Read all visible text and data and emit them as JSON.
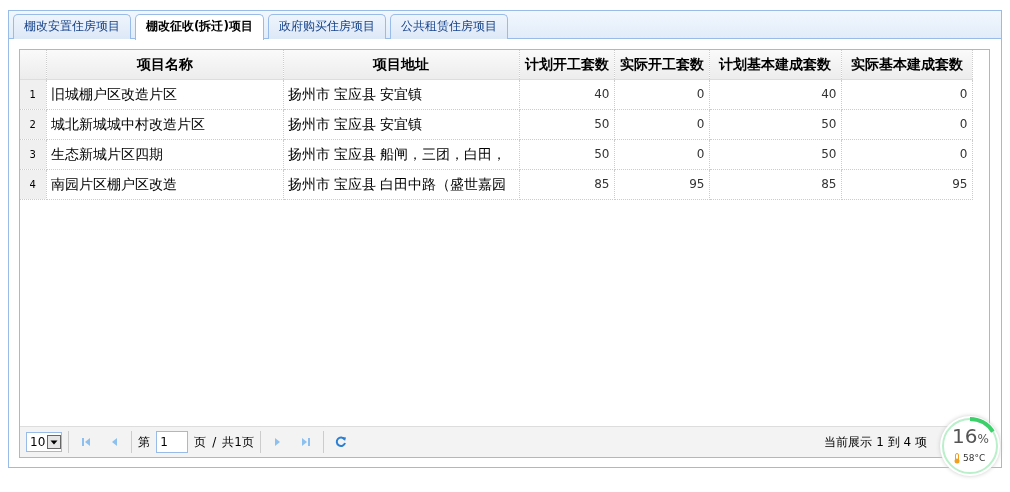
{
  "tabs": [
    {
      "label": "棚改安置住房项目",
      "selected": false
    },
    {
      "label": "棚改征收(拆迁)项目",
      "selected": true
    },
    {
      "label": "政府购买住房项目",
      "selected": false
    },
    {
      "label": "公共租赁住房项目",
      "selected": false
    }
  ],
  "table": {
    "columns": [
      "项目名称",
      "项目地址",
      "计划开工套数",
      "实际开工套数",
      "计划基本建成套数",
      "实际基本建成套数"
    ],
    "rows": [
      {
        "index": "1",
        "cells": [
          "旧城棚户区改造片区",
          "扬州市 宝应县 安宜镇",
          "40",
          "0",
          "40",
          "0"
        ]
      },
      {
        "index": "2",
        "cells": [
          "城北新城城中村改造片区",
          "扬州市 宝应县 安宜镇",
          "50",
          "0",
          "50",
          "0"
        ]
      },
      {
        "index": "3",
        "cells": [
          "生态新城片区四期",
          "扬州市 宝应县 船闸，三团，白田，",
          "50",
          "0",
          "50",
          "0"
        ]
      },
      {
        "index": "4",
        "cells": [
          "南园片区棚户区改造",
          "扬州市 宝应县 白田中路（盛世嘉园",
          "85",
          "95",
          "85",
          "95"
        ]
      }
    ]
  },
  "pager": {
    "page_size": "10",
    "page_label": "第",
    "page": "1",
    "page_suffix": "页",
    "separator": "/",
    "total_pages": "共1页",
    "info": "当前展示 1 到 4 项"
  },
  "monitor": {
    "percent": "16",
    "unit": "%",
    "level": 0.16,
    "temperature": "58°C"
  }
}
